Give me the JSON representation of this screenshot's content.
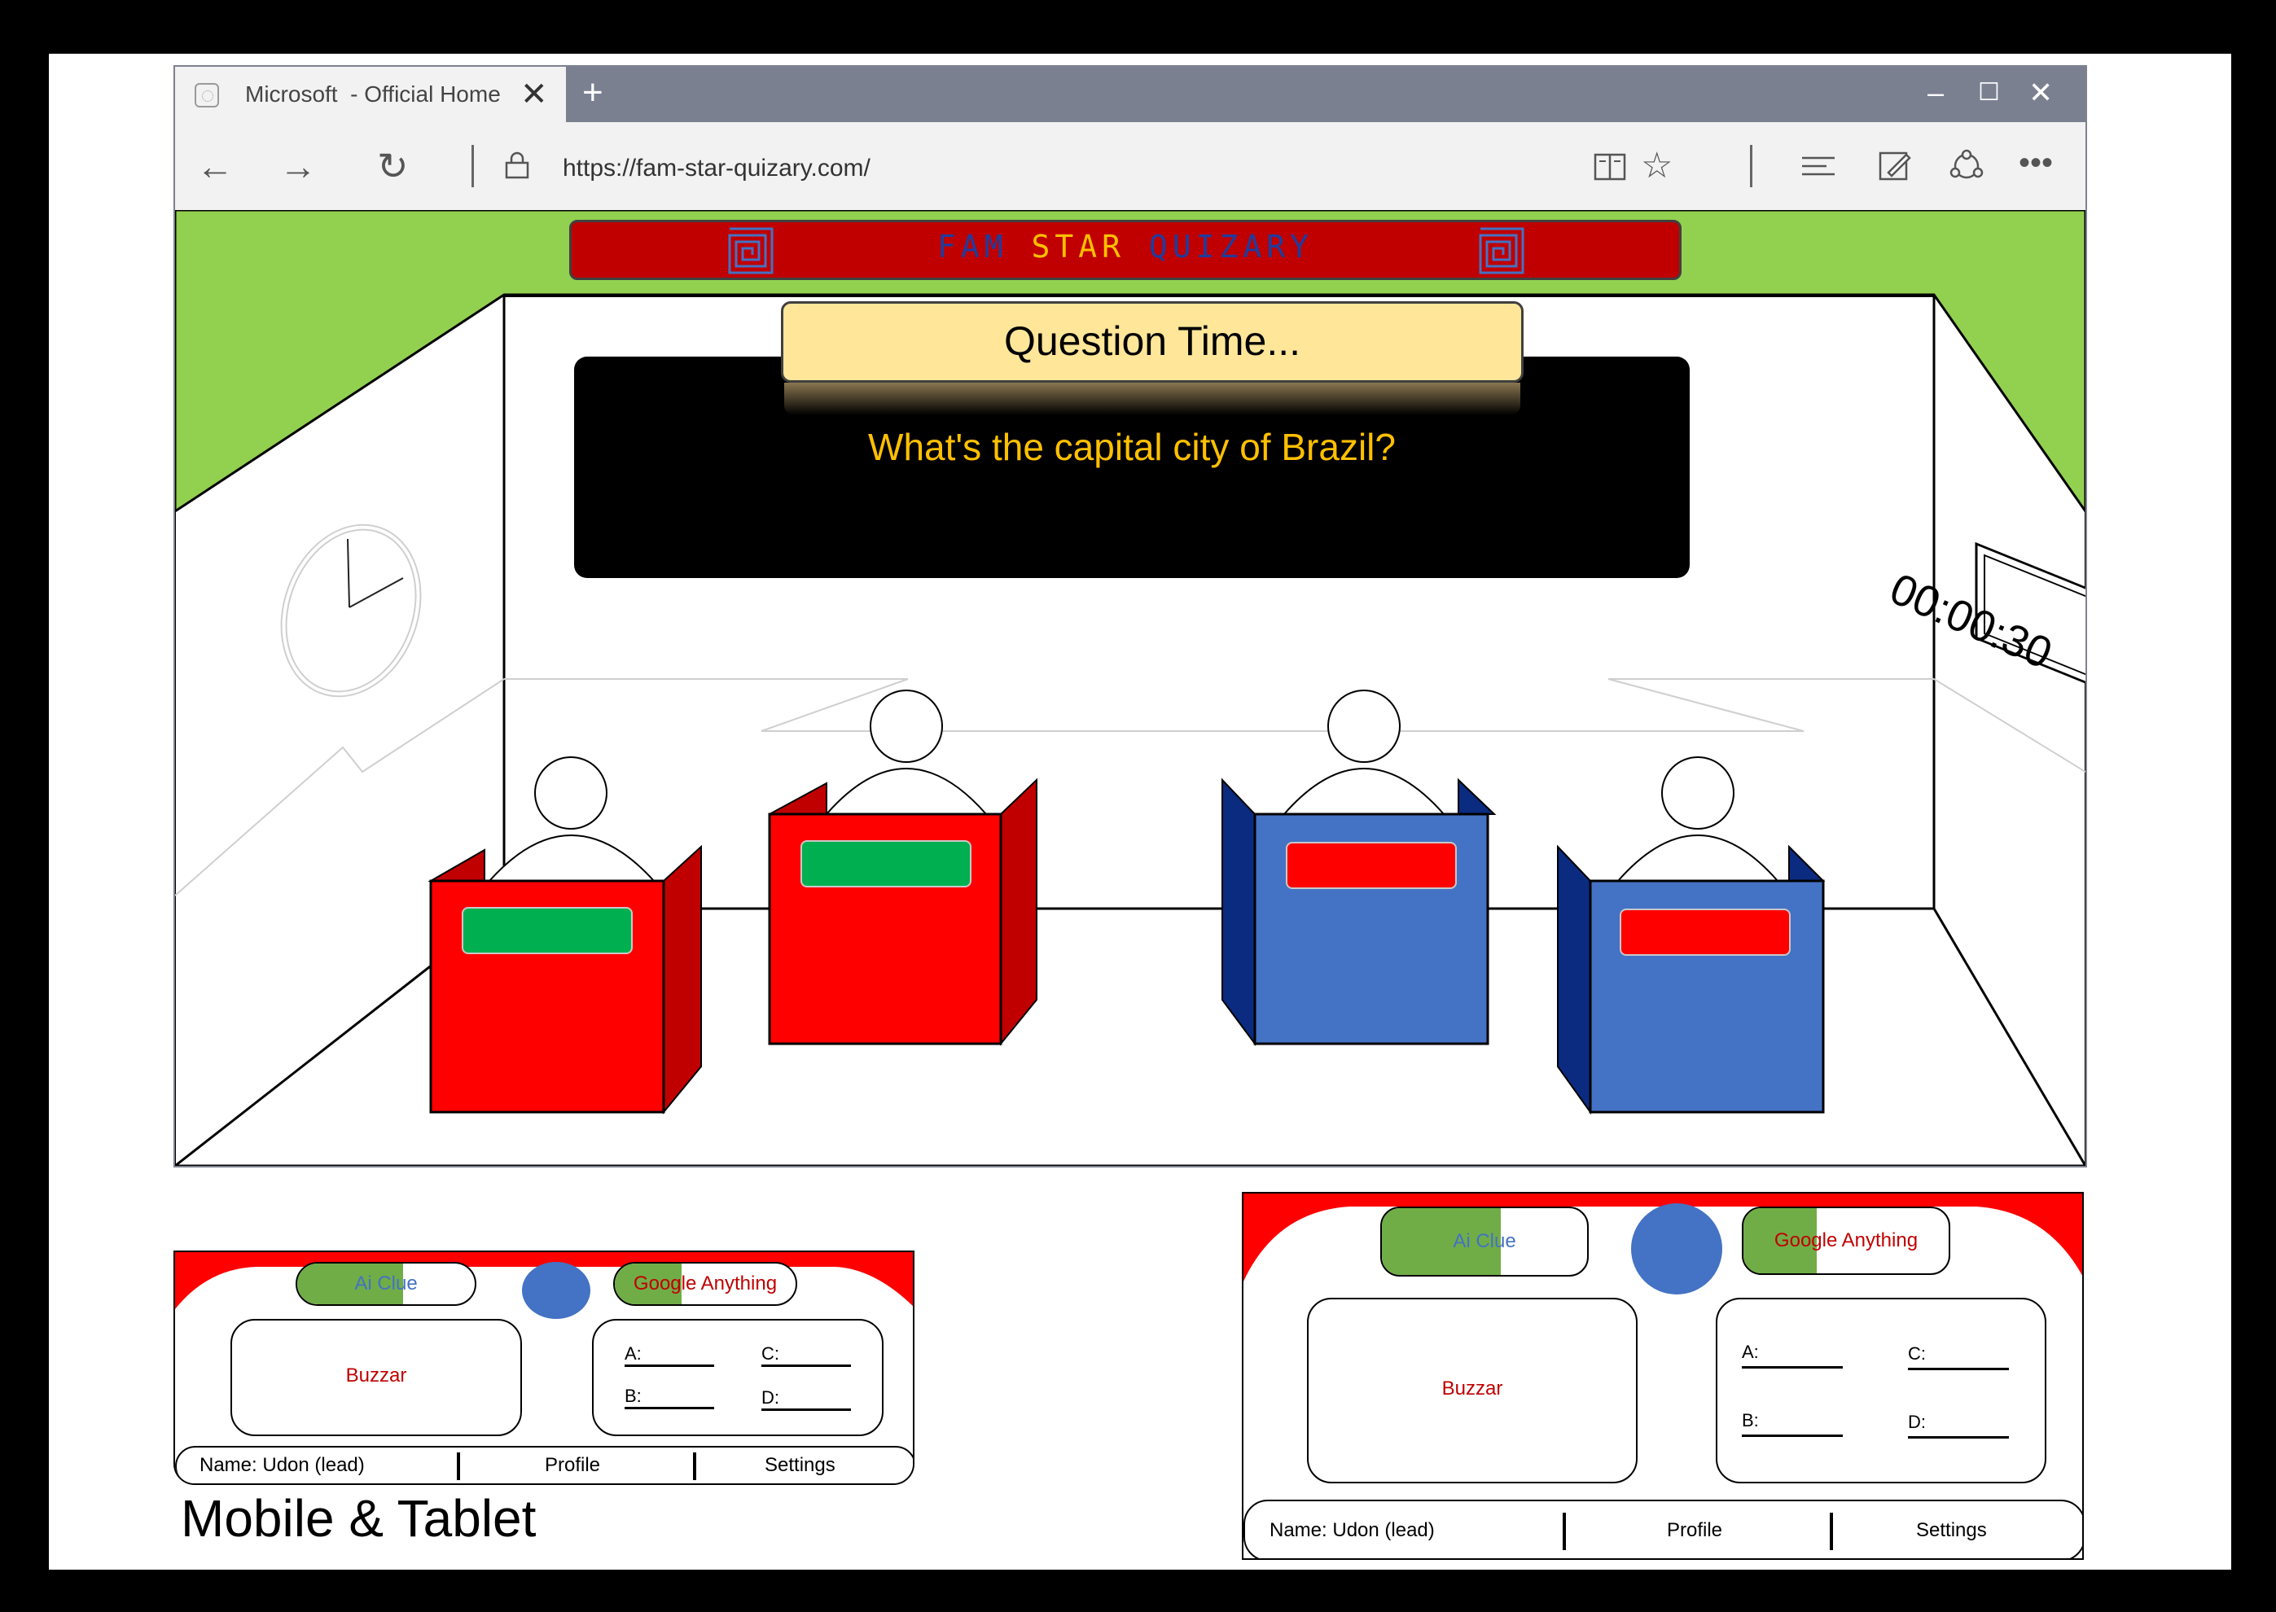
{
  "browser": {
    "tab_title": "Microsoft  - Official Home",
    "new_tab": "+",
    "url": "https://fam-star-quizary.com/",
    "window_controls": {
      "minimize": "–",
      "maximize": "☐",
      "close": "✕"
    },
    "icons": [
      "back-icon",
      "forward-icon",
      "refresh-icon",
      "lock-icon",
      "reading-view-icon",
      "favorite-icon",
      "hub-icon",
      "web-note-icon",
      "share-icon",
      "more-icon"
    ]
  },
  "game": {
    "banner": {
      "word1": "FAM",
      "word2": "STAR",
      "word3": "QUIZARY"
    },
    "question_header": "Question Time...",
    "question": "What's the capital city of Brazil?",
    "timer": "00:00:30",
    "colors": {
      "wall_green": "#92d050",
      "red_team": "#ff0000",
      "blue_team": "#4472c4",
      "lit": "#00b050",
      "unlit": "#ff0000",
      "question_text": "#ffc000"
    },
    "contestants": [
      {
        "team": "red",
        "indicator": "green"
      },
      {
        "team": "red",
        "indicator": "green"
      },
      {
        "team": "blue",
        "indicator": "red"
      },
      {
        "team": "blue",
        "indicator": "red"
      }
    ]
  },
  "controls": {
    "ai_clue": "Ai Clue",
    "google": "Google Anything",
    "buzzer": "Buzzar",
    "answers": {
      "a": "A:",
      "b": "B:",
      "c": "C:",
      "d": "D:"
    },
    "name": "Name: Udon (lead)",
    "profile": "Profile",
    "settings": "Settings"
  },
  "caption": "Mobile & Tablet"
}
